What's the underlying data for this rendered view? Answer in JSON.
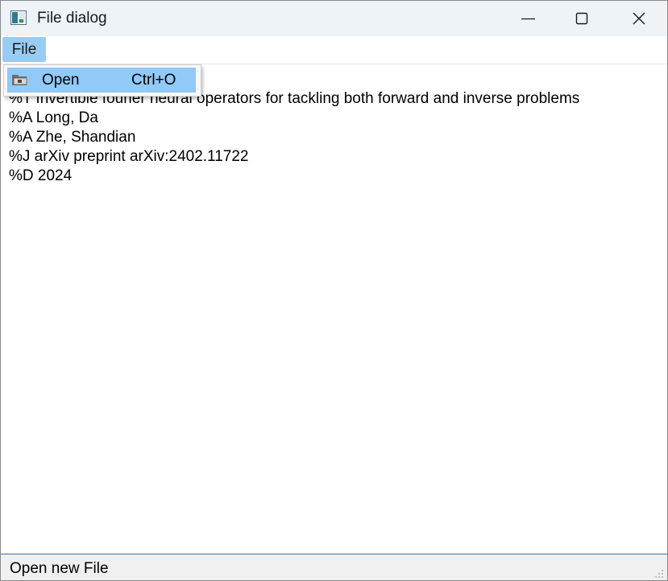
{
  "window": {
    "title": "File dialog",
    "icon": "app-window-icon"
  },
  "titlebar_controls": {
    "minimize_icon": "minimize-icon",
    "maximize_icon": "maximize-icon",
    "close_icon": "close-icon"
  },
  "menubar": {
    "items": [
      {
        "label": "File"
      }
    ]
  },
  "file_menu": {
    "items": [
      {
        "label": "Open",
        "shortcut": "Ctrl+O",
        "icon": "folder-open-icon"
      }
    ]
  },
  "editor": {
    "lines": [
      "%T Invertible fourier neural operators for tackling both forward and inverse problems",
      "%A Long, Da",
      "%A Zhe, Shandian",
      "%J arXiv preprint arXiv:2402.11722",
      "%D 2024"
    ]
  },
  "statusbar": {
    "text": "Open new File"
  },
  "colors": {
    "titlebar_bg": "#eef3f8",
    "menu_highlight": "#99ccf2",
    "dropdown_highlight": "#91c9f7",
    "statusbar_bg": "#f0f0f0"
  }
}
